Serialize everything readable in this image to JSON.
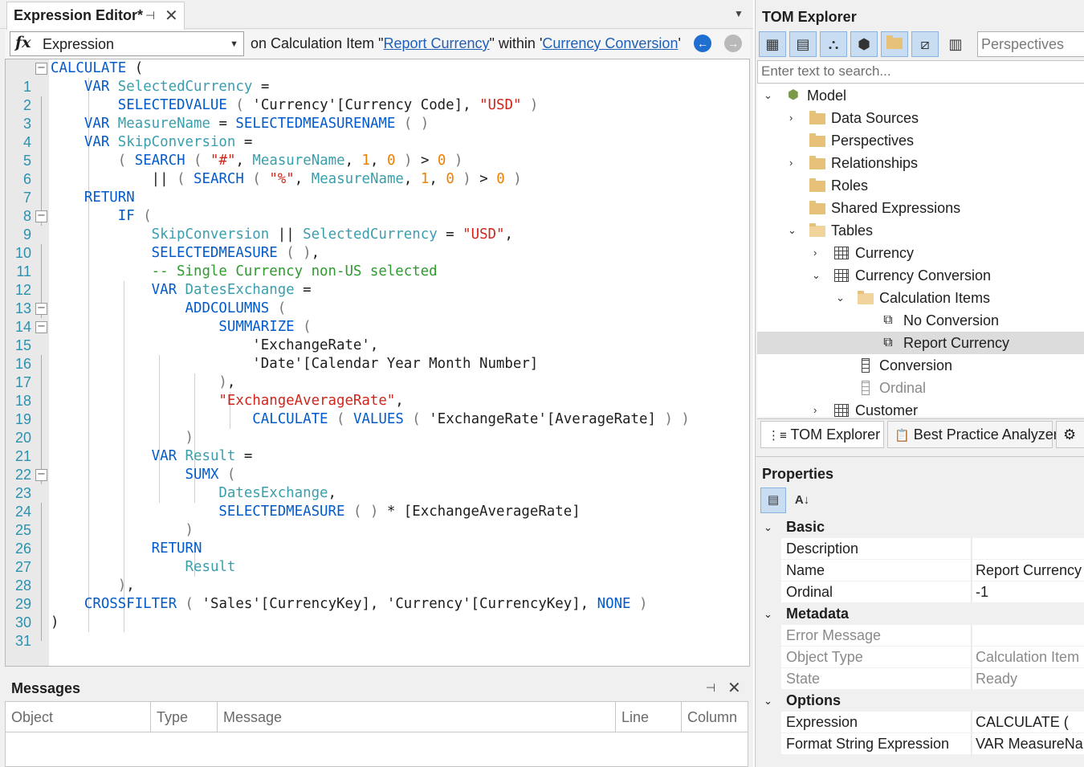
{
  "editor": {
    "tab_title": "Expression Editor*",
    "property_combo": {
      "icon": "fx",
      "value": "Expression"
    },
    "context": {
      "prefix": "on Calculation Item \"",
      "item_link": "Report Currency",
      "middle": "\" within '",
      "group_link": "Currency Conversion",
      "suffix": "'"
    },
    "line_numbers": [
      "1",
      "2",
      "3",
      "4",
      "5",
      "6",
      "7",
      "8",
      "9",
      "10",
      "11",
      "12",
      "13",
      "14",
      "15",
      "16",
      "17",
      "18",
      "19",
      "20",
      "21",
      "22",
      "23",
      "24",
      "25",
      "26",
      "27",
      "28",
      "29",
      "30",
      "31"
    ],
    "folds": [
      "−",
      "−",
      "−",
      "−",
      "−",
      "−"
    ]
  },
  "messages": {
    "title": "Messages",
    "columns": [
      "Object",
      "Type",
      "Message",
      "Line",
      "Column"
    ]
  },
  "tom": {
    "title": "TOM Explorer",
    "perspectives_placeholder": "Perspectives",
    "search_placeholder": "Enter text to search...",
    "tree": [
      {
        "label": "Model"
      },
      {
        "label": "Data Sources"
      },
      {
        "label": "Perspectives"
      },
      {
        "label": "Relationships"
      },
      {
        "label": "Roles"
      },
      {
        "label": "Shared Expressions"
      },
      {
        "label": "Tables"
      },
      {
        "label": "Currency"
      },
      {
        "label": "Currency Conversion"
      },
      {
        "label": "Calculation Items"
      },
      {
        "label": "No Conversion"
      },
      {
        "label": "Report Currency",
        "selected": true
      },
      {
        "label": "Conversion"
      },
      {
        "label": "Ordinal",
        "dimmed": true
      },
      {
        "label": "Customer"
      }
    ],
    "bottom_tabs": [
      "TOM Explorer",
      "Best Practice Analyzer"
    ]
  },
  "properties": {
    "title": "Properties",
    "categories": [
      {
        "name": "Basic",
        "rows": [
          {
            "name": "Description",
            "value": ""
          },
          {
            "name": "Name",
            "value": "Report Currency"
          },
          {
            "name": "Ordinal",
            "value": "-1"
          }
        ]
      },
      {
        "name": "Metadata",
        "rows": [
          {
            "name": "Error Message",
            "value": ""
          },
          {
            "name": "Object Type",
            "value": "Calculation Item"
          },
          {
            "name": "State",
            "value": "Ready"
          }
        ]
      },
      {
        "name": "Options",
        "rows": [
          {
            "name": "Expression",
            "value": "CALCULATE (    VA"
          },
          {
            "name": "Format String Expression",
            "value": "VAR MeasureNan"
          }
        ]
      }
    ]
  },
  "colors": {
    "keyword": "#035aca",
    "variable": "#3a9ead",
    "string": "#d1251b",
    "number": "#ee7f00",
    "comment": "#2f9a2f",
    "selection": "#dcdcdc"
  }
}
